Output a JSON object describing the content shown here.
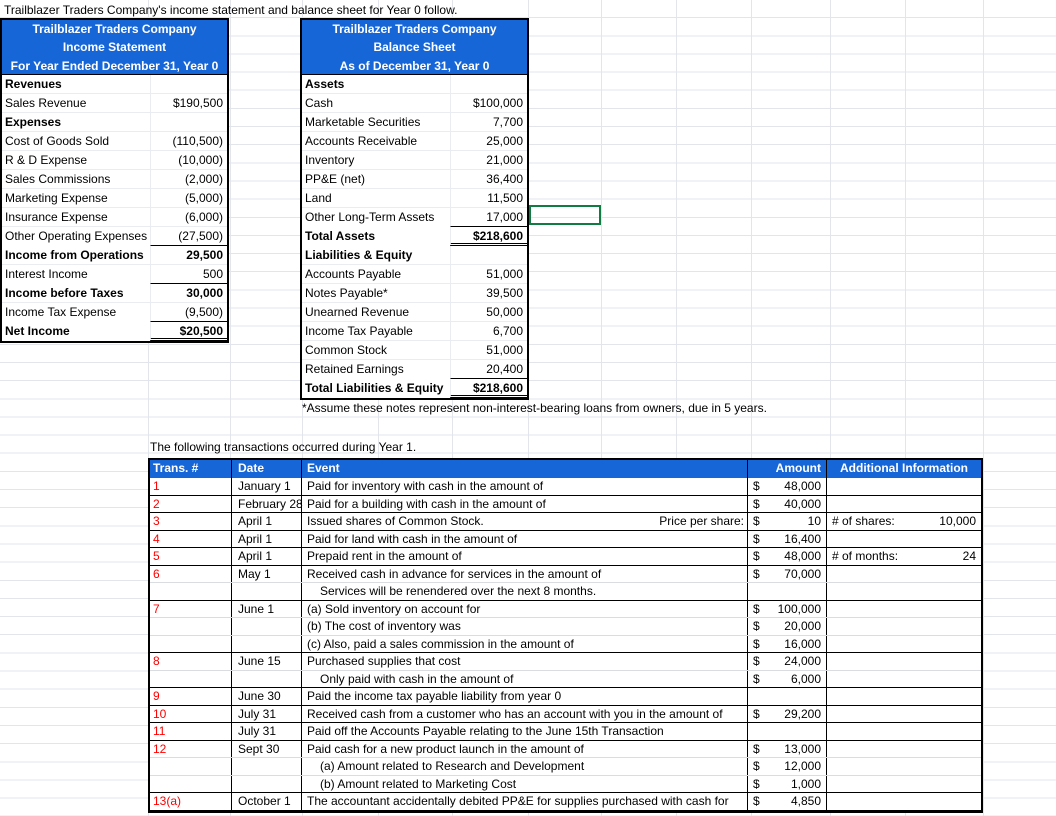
{
  "title": "Trailblazer Traders Company's income statement and balance sheet for Year 0 follow.",
  "income_statement": {
    "header_line1": "Trailblazer Traders Company",
    "header_line2": "Income Statement",
    "header_line3": "For Year Ended December 31, Year 0",
    "rows": [
      {
        "label": "Revenues",
        "value": ""
      },
      {
        "label": "Sales Revenue",
        "value": "$190,500"
      },
      {
        "label": "Expenses",
        "value": ""
      },
      {
        "label": "Cost of Goods Sold",
        "value": "(110,500)"
      },
      {
        "label": "R & D Expense",
        "value": "(10,000)"
      },
      {
        "label": "Sales Commissions",
        "value": "(2,000)"
      },
      {
        "label": "Marketing Expense",
        "value": "(5,000)"
      },
      {
        "label": "Insurance Expense",
        "value": "(6,000)"
      },
      {
        "label": "Other Operating Expenses",
        "value": "(27,500)"
      },
      {
        "label": "Income from Operations",
        "value": "29,500"
      },
      {
        "label": "Interest Income",
        "value": "500"
      },
      {
        "label": "Income before Taxes",
        "value": "30,000"
      },
      {
        "label": "Income Tax Expense",
        "value": "(9,500)"
      },
      {
        "label": "Net Income",
        "value": "$20,500"
      }
    ]
  },
  "balance_sheet": {
    "header_line1": "Trailblazer Traders Company",
    "header_line2": "Balance Sheet",
    "header_line3": "As of December 31, Year 0",
    "rows": [
      {
        "label": "Assets",
        "value": ""
      },
      {
        "label": "Cash",
        "value": "$100,000"
      },
      {
        "label": "Marketable Securities",
        "value": "7,700"
      },
      {
        "label": "Accounts Receivable",
        "value": "25,000"
      },
      {
        "label": "Inventory",
        "value": "21,000"
      },
      {
        "label": "PP&E (net)",
        "value": "36,400"
      },
      {
        "label": "Land",
        "value": "11,500"
      },
      {
        "label": "Other Long-Term Assets",
        "value": "17,000"
      },
      {
        "label": "Total Assets",
        "value": "$218,600"
      },
      {
        "label": "Liabilities & Equity",
        "value": ""
      },
      {
        "label": "Accounts Payable",
        "value": "51,000"
      },
      {
        "label": "Notes Payable*",
        "value": "39,500"
      },
      {
        "label": "Unearned Revenue",
        "value": "50,000"
      },
      {
        "label": "Income Tax Payable",
        "value": "6,700"
      },
      {
        "label": "Common Stock",
        "value": "51,000"
      },
      {
        "label": "Retained Earnings",
        "value": "20,400"
      },
      {
        "label": "Total Liabilities & Equity",
        "value": "$218,600"
      }
    ],
    "footnote": "*Assume these notes represent non-interest-bearing loans from owners, due in 5 years."
  },
  "transactions": {
    "intro": "The following transactions occurred during Year 1.",
    "columns": {
      "num": "Trans. #",
      "date": "Date",
      "event": "Event",
      "amount": "Amount",
      "addl": "Additional Information"
    },
    "rows": [
      {
        "num": "1",
        "date": "January 1",
        "event": "Paid for inventory with cash in the amount of",
        "note": "",
        "cur": "$",
        "amount": "48,000",
        "addl_label": "",
        "addl_value": ""
      },
      {
        "num": "2",
        "date": "February 28",
        "event": "Paid for a building with cash in the amount of",
        "note": "",
        "cur": "$",
        "amount": "40,000",
        "addl_label": "",
        "addl_value": ""
      },
      {
        "num": "3",
        "date": "April 1",
        "event": "Issued shares of Common Stock.",
        "note": "Price per share:",
        "cur": "$",
        "amount": "10",
        "addl_label": "# of shares:",
        "addl_value": "10,000"
      },
      {
        "num": "4",
        "date": "April 1",
        "event": "Paid for land with cash in the amount of",
        "note": "",
        "cur": "$",
        "amount": "16,400",
        "addl_label": "",
        "addl_value": ""
      },
      {
        "num": "5",
        "date": "April 1",
        "event": "Prepaid rent in the amount of",
        "note": "",
        "cur": "$",
        "amount": "48,000",
        "addl_label": "# of months:",
        "addl_value": "24"
      },
      {
        "num": "6",
        "date": "May 1",
        "event": "Received cash in advance for services in the amount of",
        "note": "",
        "cur": "$",
        "amount": "70,000",
        "addl_label": "",
        "addl_value": ""
      },
      {
        "num": "",
        "date": "",
        "event": "Services will be renendered over the next 8 months.",
        "note": "",
        "cur": "",
        "amount": "",
        "addl_label": "",
        "addl_value": ""
      },
      {
        "num": "7",
        "date": "June 1",
        "event": "(a) Sold inventory on account for",
        "note": "",
        "cur": "$",
        "amount": "100,000",
        "addl_label": "",
        "addl_value": ""
      },
      {
        "num": "",
        "date": "",
        "event": "(b) The cost of inventory was",
        "note": "",
        "cur": "$",
        "amount": "20,000",
        "addl_label": "",
        "addl_value": ""
      },
      {
        "num": "",
        "date": "",
        "event": "(c) Also, paid a sales commission in the amount of",
        "note": "",
        "cur": "$",
        "amount": "16,000",
        "addl_label": "",
        "addl_value": ""
      },
      {
        "num": "8",
        "date": "June 15",
        "event": "Purchased supplies that cost",
        "note": "",
        "cur": "$",
        "amount": "24,000",
        "addl_label": "",
        "addl_value": ""
      },
      {
        "num": "",
        "date": "",
        "event": "Only paid with cash in the amount of",
        "note": "",
        "cur": "$",
        "amount": "6,000",
        "addl_label": "",
        "addl_value": ""
      },
      {
        "num": "9",
        "date": "June 30",
        "event": "Paid the income tax payable liability from year 0",
        "note": "",
        "cur": "",
        "amount": "",
        "addl_label": "",
        "addl_value": ""
      },
      {
        "num": "10",
        "date": "July 31",
        "event": "Received cash from a customer who has an account with you in the amount of",
        "note": "",
        "cur": "$",
        "amount": "29,200",
        "addl_label": "",
        "addl_value": ""
      },
      {
        "num": "11",
        "date": "July 31",
        "event": "Paid off the Accounts Payable relating to the June 15th Transaction",
        "note": "",
        "cur": "",
        "amount": "",
        "addl_label": "",
        "addl_value": ""
      },
      {
        "num": "12",
        "date": "Sept 30",
        "event": "Paid cash for a new product launch in the amount of",
        "note": "",
        "cur": "$",
        "amount": "13,000",
        "addl_label": "",
        "addl_value": ""
      },
      {
        "num": "",
        "date": "",
        "event": "(a) Amount related to Research and Development",
        "note": "",
        "cur": "$",
        "amount": "12,000",
        "addl_label": "",
        "addl_value": ""
      },
      {
        "num": "",
        "date": "",
        "event": "(b) Amount related to Marketing Cost",
        "note": "",
        "cur": "$",
        "amount": "1,000",
        "addl_label": "",
        "addl_value": ""
      },
      {
        "num": "13(a)",
        "date": "October 1",
        "event": "The accountant accidentally debited PP&E for supplies purchased with cash for",
        "note": "",
        "cur": "$",
        "amount": "4,850",
        "addl_label": "",
        "addl_value": ""
      }
    ]
  },
  "colors": {
    "header_blue": "#1766d8",
    "transaction_number_red": "#FF0000",
    "selection_green": "#107C41",
    "gridline": "#e2e6ec"
  }
}
